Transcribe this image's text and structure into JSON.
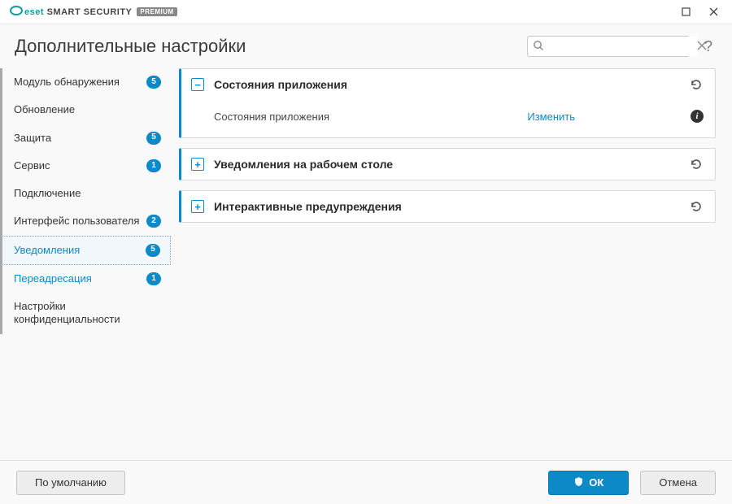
{
  "titlebar": {
    "brand_mark": "eset",
    "brand_product": "SMART SECURITY",
    "brand_edition": "PREMIUM"
  },
  "header": {
    "title": "Дополнительные настройки",
    "search_placeholder": ""
  },
  "sidebar": {
    "items": [
      {
        "label": "Модуль обнаружения",
        "badge": "5",
        "marked": true
      },
      {
        "label": "Обновление",
        "badge": "",
        "marked": true
      },
      {
        "label": "Защита",
        "badge": "5",
        "marked": true
      },
      {
        "label": "Сервис",
        "badge": "1",
        "marked": true
      },
      {
        "label": "Подключение",
        "badge": "",
        "marked": true
      },
      {
        "label": "Интерфейс пользователя",
        "badge": "2",
        "marked": true
      },
      {
        "label": "Уведомления",
        "badge": "5",
        "marked": true,
        "selected": true
      },
      {
        "label": "Переадресация",
        "badge": "1",
        "marked": true,
        "child": true,
        "accent": true
      },
      {
        "label": "Настройки конфиденциальности",
        "badge": "",
        "marked": true
      }
    ]
  },
  "content": {
    "panels": [
      {
        "expanded": true,
        "title": "Состояния приложения",
        "rows": [
          {
            "label": "Состояния приложения",
            "action": "Изменить"
          }
        ]
      },
      {
        "expanded": false,
        "title": "Уведомления на рабочем столе"
      },
      {
        "expanded": false,
        "title": "Интерактивные предупреждения"
      }
    ]
  },
  "footer": {
    "default_label": "По умолчанию",
    "ok_label": "ОК",
    "cancel_label": "Отмена"
  }
}
